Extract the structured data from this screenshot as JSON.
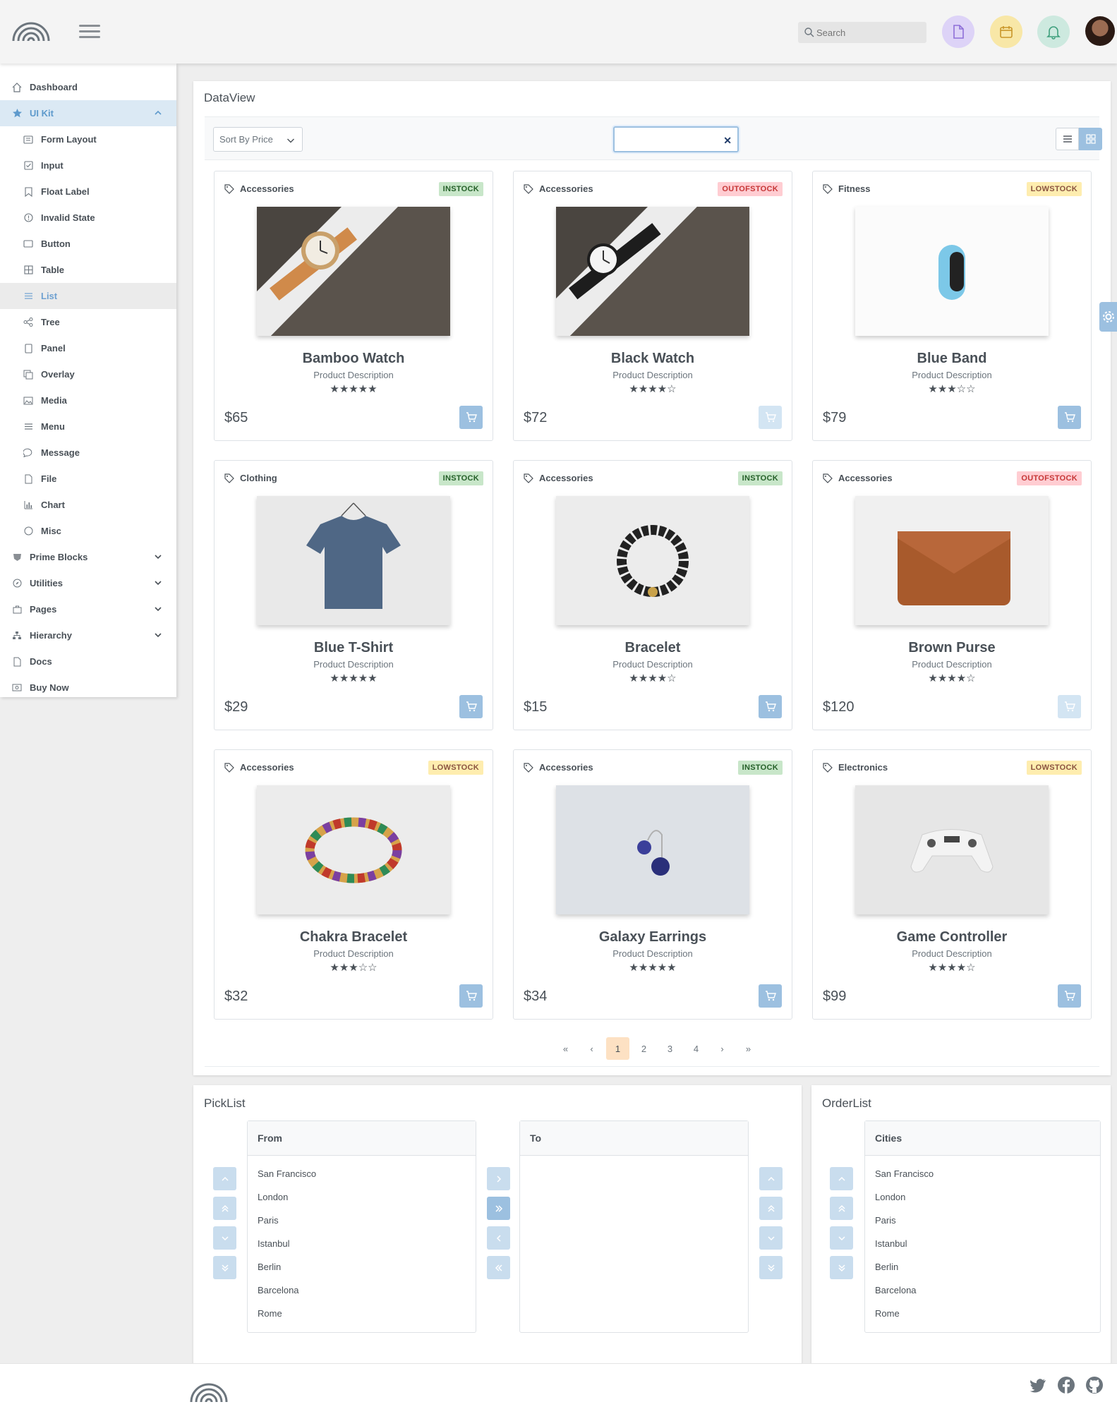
{
  "search": {
    "placeholder": "Search"
  },
  "sidebar": {
    "items": [
      {
        "label": "Dashboard"
      },
      {
        "label": "UI Kit"
      },
      {
        "label": "Form Layout"
      },
      {
        "label": "Input"
      },
      {
        "label": "Float Label"
      },
      {
        "label": "Invalid State"
      },
      {
        "label": "Button"
      },
      {
        "label": "Table"
      },
      {
        "label": "List"
      },
      {
        "label": "Tree"
      },
      {
        "label": "Panel"
      },
      {
        "label": "Overlay"
      },
      {
        "label": "Media"
      },
      {
        "label": "Menu"
      },
      {
        "label": "Message"
      },
      {
        "label": "File"
      },
      {
        "label": "Chart"
      },
      {
        "label": "Misc"
      },
      {
        "label": "Prime Blocks"
      },
      {
        "label": "Utilities"
      },
      {
        "label": "Pages"
      },
      {
        "label": "Hierarchy"
      },
      {
        "label": "Docs"
      },
      {
        "label": "Buy Now"
      }
    ]
  },
  "dataview": {
    "title": "DataView",
    "sort_label": "Sort By Price",
    "filter_value": "",
    "products": [
      {
        "category": "Accessories",
        "status": "INSTOCK",
        "name": "Bamboo Watch",
        "description": "Product Description",
        "stars": "★★★★★",
        "rating": 5,
        "price": "$65"
      },
      {
        "category": "Accessories",
        "status": "OUTOFSTOCK",
        "name": "Black Watch",
        "description": "Product Description",
        "stars": "★★★★☆",
        "rating": 4,
        "price": "$72"
      },
      {
        "category": "Fitness",
        "status": "LOWSTOCK",
        "name": "Blue Band",
        "description": "Product Description",
        "stars": "★★★☆☆",
        "rating": 3,
        "price": "$79"
      },
      {
        "category": "Clothing",
        "status": "INSTOCK",
        "name": "Blue T-Shirt",
        "description": "Product Description",
        "stars": "★★★★★",
        "rating": 5,
        "price": "$29"
      },
      {
        "category": "Accessories",
        "status": "INSTOCK",
        "name": "Bracelet",
        "description": "Product Description",
        "stars": "★★★★☆",
        "rating": 4,
        "price": "$15"
      },
      {
        "category": "Accessories",
        "status": "OUTOFSTOCK",
        "name": "Brown Purse",
        "description": "Product Description",
        "stars": "★★★★☆",
        "rating": 4,
        "price": "$120"
      },
      {
        "category": "Accessories",
        "status": "LOWSTOCK",
        "name": "Chakra Bracelet",
        "description": "Product Description",
        "stars": "★★★☆☆",
        "rating": 3,
        "price": "$32"
      },
      {
        "category": "Accessories",
        "status": "INSTOCK",
        "name": "Galaxy Earrings",
        "description": "Product Description",
        "stars": "★★★★★",
        "rating": 5,
        "price": "$34"
      },
      {
        "category": "Electronics",
        "status": "LOWSTOCK",
        "name": "Game Controller",
        "description": "Product Description",
        "stars": "★★★★☆",
        "rating": 4,
        "price": "$99"
      }
    ],
    "pagination": {
      "first": "«",
      "prev": "‹",
      "pages": [
        "1",
        "2",
        "3",
        "4"
      ],
      "current": "1",
      "next": "›",
      "last": "»"
    }
  },
  "picklist": {
    "title": "PickList",
    "source_header": "From",
    "target_header": "To",
    "source_items": [
      "San Francisco",
      "London",
      "Paris",
      "Istanbul",
      "Berlin",
      "Barcelona",
      "Rome"
    ],
    "target_items": []
  },
  "orderlist": {
    "title": "OrderList",
    "header": "Cities",
    "items": [
      "San Francisco",
      "London",
      "Paris",
      "Istanbul",
      "Berlin",
      "Barcelona",
      "Rome"
    ]
  },
  "colors": {
    "accent": "#9cc0e0",
    "instock_bg": "#c8e6c9",
    "outofstock_bg": "#ffcdd2",
    "lowstock_bg": "#feedaf",
    "page_current_bg": "#fde1c3"
  },
  "icons": [
    "logo-arcs",
    "hamburger-icon",
    "search-icon",
    "file-icon",
    "calendar-icon",
    "bell-icon",
    "tag-icon",
    "cart-icon",
    "list-view-icon",
    "grid-view-icon",
    "gear-icon",
    "twitter-icon",
    "facebook-icon",
    "github-icon"
  ]
}
